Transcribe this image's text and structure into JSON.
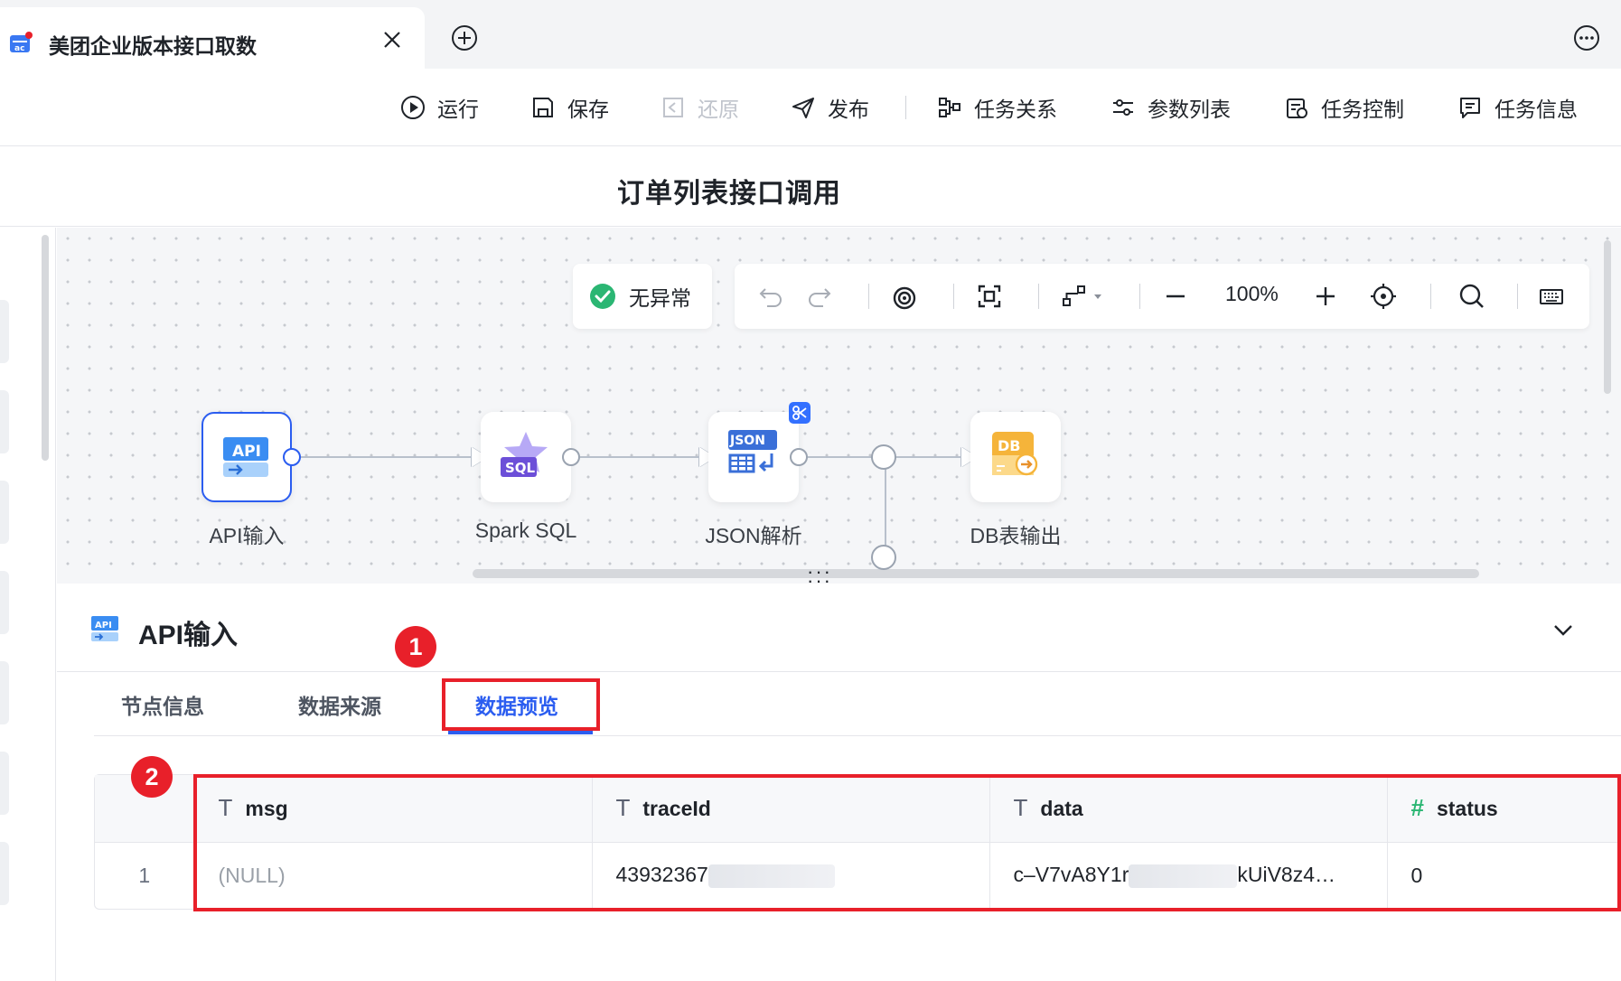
{
  "tab": {
    "title": "美团企业版本接口取数"
  },
  "toolbar": {
    "run": "运行",
    "save": "保存",
    "restore": "还原",
    "publish": "发布",
    "task_relation": "任务关系",
    "param_list": "参数列表",
    "task_control": "任务控制",
    "task_info": "任务信息"
  },
  "page_title": "订单列表接口调用",
  "canvas": {
    "status": "无异常",
    "zoom": "100%",
    "nodes": [
      {
        "label": "API输入",
        "icon_text": "API"
      },
      {
        "label": "Spark SQL",
        "icon_text": "SQL"
      },
      {
        "label": "JSON解析",
        "icon_text": "JSON"
      },
      {
        "label": "DB表输出",
        "icon_text": "DB"
      }
    ]
  },
  "panel": {
    "title": "API输入",
    "icon_text": "API",
    "tabs": [
      "节点信息",
      "数据来源",
      "数据预览"
    ],
    "active_tab": 2
  },
  "table": {
    "columns": [
      {
        "type": "T",
        "name": "msg"
      },
      {
        "type": "T",
        "name": "traceId"
      },
      {
        "type": "T",
        "name": "data"
      },
      {
        "type": "#",
        "name": "status"
      }
    ],
    "rows": [
      {
        "index": "1",
        "msg": "(NULL)",
        "traceId_prefix": "43932367",
        "data_prefix": "c–V7vA8Y1r",
        "data_suffix": "kUiV8z4…",
        "status": "0"
      }
    ]
  },
  "annotations": {
    "marker1": "1",
    "marker2": "2"
  },
  "colors": {
    "accent": "#2b5df0",
    "annotation": "#e8202a",
    "ok": "#2bb673"
  }
}
